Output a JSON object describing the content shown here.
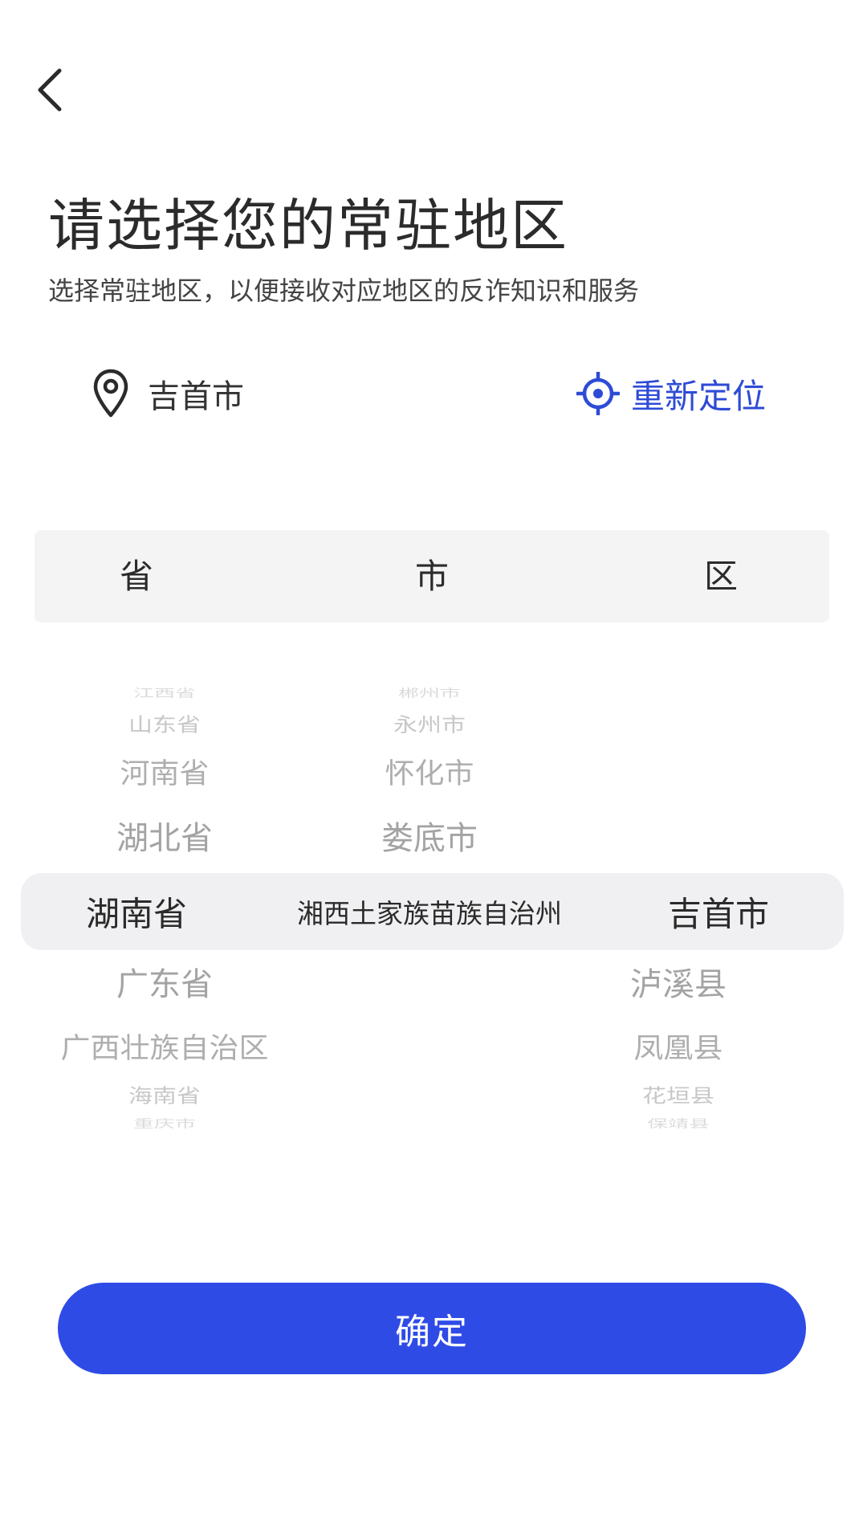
{
  "header": {
    "title": "请选择您的常驻地区",
    "subtitle": "选择常驻地区，以便接收对应地区的反诈知识和服务"
  },
  "location": {
    "current": "吉首市",
    "relocate_label": "重新定位"
  },
  "columns": {
    "province": "省",
    "city": "市",
    "district": "区"
  },
  "picker": {
    "provinces": [
      "江西省",
      "山东省",
      "河南省",
      "湖北省",
      "湖南省",
      "广东省",
      "广西壮族自治区",
      "海南省",
      "重庆市"
    ],
    "cities": [
      "郴州市",
      "永州市",
      "怀化市",
      "娄底市",
      "湘西土家族苗族自治州"
    ],
    "districts": [
      "吉首市",
      "泸溪县",
      "凤凰县",
      "花垣县",
      "保靖县"
    ],
    "selected": {
      "province": "湖南省",
      "city": "湘西土家族苗族自治州",
      "district": "吉首市"
    }
  },
  "footer": {
    "confirm_label": "确定"
  },
  "colors": {
    "accent": "#2f4be6",
    "link": "#2e4bd6"
  },
  "icons": {
    "back": "chevron-left-icon",
    "location": "map-pin-icon",
    "relocate": "crosshair-icon"
  }
}
